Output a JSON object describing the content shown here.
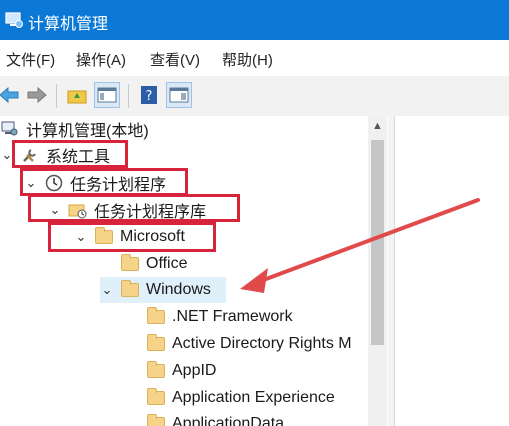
{
  "window": {
    "title": "计算机管理",
    "icon": "computer-management-icon"
  },
  "menu": [
    "文件(F)",
    "操作(A)",
    "查看(V)",
    "帮助(H)"
  ],
  "toolbar": {
    "buttons": [
      "back-icon",
      "forward-icon",
      "up-folder-icon",
      "show-hide-tree-icon",
      "help-icon",
      "console-pane-icon"
    ]
  },
  "tree": {
    "root": "计算机管理(本地)",
    "system_tools": "系统工具",
    "task_scheduler": "任务计划程序",
    "task_scheduler_library": "任务计划程序库",
    "microsoft": "Microsoft",
    "office": "Office",
    "windows": "Windows",
    "children": [
      ".NET Framework",
      "Active Directory Rights M",
      "AppID",
      "Application Experience",
      "ApplicationData"
    ]
  },
  "annotation": {
    "highlight_color": "#d7243a",
    "arrow_color": "#e04a4a"
  }
}
